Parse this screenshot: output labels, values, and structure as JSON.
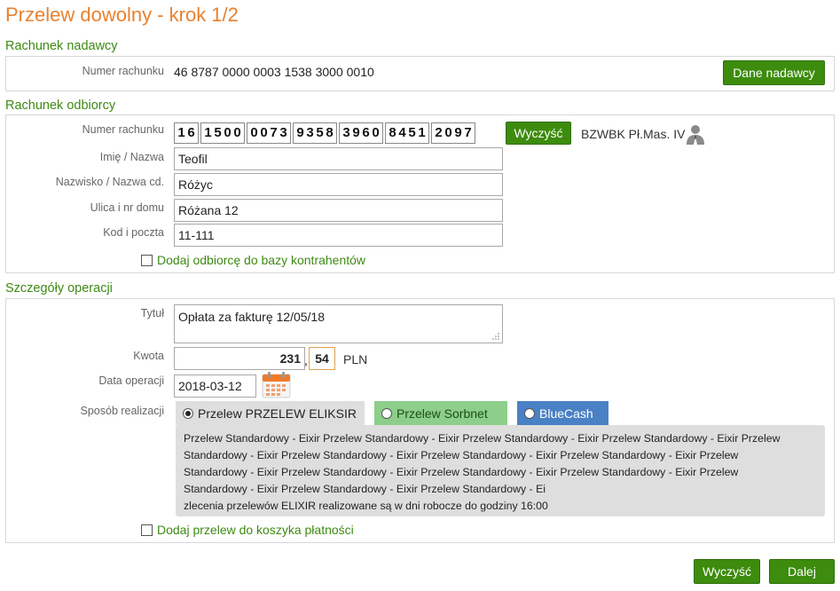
{
  "page": {
    "title": "Przelew dowolny - krok 1/2"
  },
  "sender": {
    "section_title": "Rachunek nadawcy",
    "account_label": "Numer rachunku",
    "account_value": "46 8787 0000 0003 1538 3000 0010",
    "details_button": "Dane nadawcy"
  },
  "recipient": {
    "section_title": "Rachunek odbiorcy",
    "account_label": "Numer rachunku",
    "account_groups": [
      "16",
      "1500",
      "0073",
      "9358",
      "3960",
      "8451",
      "2097"
    ],
    "clear_button": "Wyczyść",
    "bank_name": "BZWBK Pł.Mas. IV",
    "name_label": "Imię / Nazwa",
    "name_value": "Teofil",
    "surname_label": "Nazwisko / Nazwa cd.",
    "surname_value": "Różyc",
    "street_label": "Ulica i nr domu",
    "street_value": "Różana 12",
    "postal_label": "Kod i poczta",
    "postal_value": "11-111",
    "add_contractor_label": "Dodaj odbiorcę do bazy kontrahentów"
  },
  "operation": {
    "section_title": "Szczegóły operacji",
    "title_label": "Tytuł",
    "title_value": "Opłata za fakturę 12/05/18",
    "amount_label": "Kwota",
    "amount_int": "231",
    "amount_sep": ",",
    "amount_dec": "54",
    "currency": "PLN",
    "date_label": "Data operacji",
    "date_value": "2018-03-12",
    "method_label": "Sposób realizacji",
    "methods": [
      {
        "label": "Przelew PRZELEW ELIKSIR",
        "selected": true
      },
      {
        "label": "Przelew Sorbnet",
        "selected": false
      },
      {
        "label": "BlueCash",
        "selected": false
      }
    ],
    "info_lines": [
      "Przelew Standardowy - Eixir Przelew Standardowy - Eixir Przelew Standardowy - Eixir Przelew Standardowy - Eixir Przelew",
      "Standardowy - Eixir Przelew Standardowy - Eixir Przelew Standardowy - Eixir Przelew Standardowy - Eixir Przelew",
      "Standardowy - Eixir Przelew Standardowy - Eixir Przelew Standardowy - Eixir Przelew Standardowy - Eixir Przelew",
      "Standardowy - Eixir Przelew Standardowy - Eixir Przelew Standardowy - Ei",
      "zlecenia przelewów ELIXIR realizowane są w dni robocze do godziny 16:00"
    ],
    "add_basket_label": "Dodaj przelew do koszyka płatności"
  },
  "footer": {
    "clear_button": "Wyczyść",
    "next_button": "Dalej"
  },
  "colors": {
    "accent_orange": "#e8812f",
    "brand_green": "#3d8c0e",
    "section_green": "#3e8a14",
    "sorbnet_tab": "#8cce8a",
    "bluecash_tab": "#4a80c4"
  }
}
